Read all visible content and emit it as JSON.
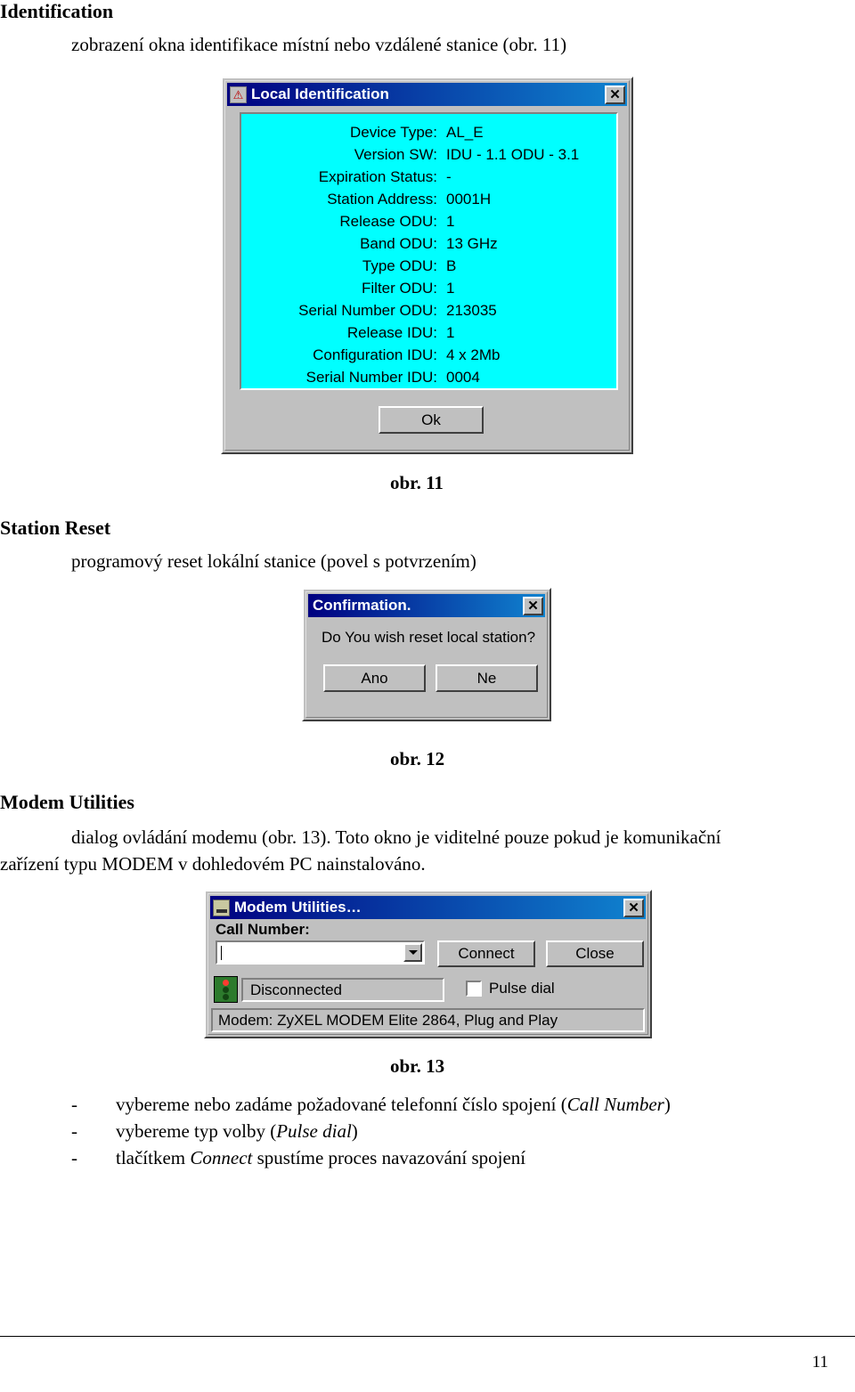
{
  "doc": {
    "section1_title": "Identification",
    "section1_text": "zobrazení okna identifikace místní nebo vzdálené stanice (obr. 11)",
    "fig11_caption": "obr. 11",
    "section2_title": "Station Reset",
    "section2_text": "programový reset lokální stanice (povel s potvrzením)",
    "fig12_caption": "obr. 12",
    "section3_title": "Modem Utilities",
    "section3_text_line1": "dialog ovládání modemu (obr. 13). Toto okno je viditelné pouze pokud je komunikační",
    "section3_text_line2": "zařízení typu MODEM v dohledovém PC nainstalováno.",
    "fig13_caption": "obr. 13",
    "bullets": [
      {
        "dash": "-",
        "text_before": "vybereme nebo zadáme požadované telefonní číslo spojení (",
        "italic": "Call Number",
        "text_after": ")"
      },
      {
        "dash": "-",
        "text_before": "vybereme typ volby (",
        "italic": "Pulse dial",
        "text_after": ")"
      },
      {
        "dash": "-",
        "text_before": "tlačítkem ",
        "italic": "Connect",
        "text_after": " spustíme proces navazování spojení"
      }
    ],
    "page_number": "11"
  },
  "ident_dialog": {
    "title": "Local Identification",
    "icon": "warning-icon",
    "close_label": "✕",
    "rows": [
      {
        "label": "Device Type:",
        "value": "AL_E"
      },
      {
        "label": "Version SW:",
        "value": "IDU - 1.1    ODU - 3.1"
      },
      {
        "label": "Expiration Status:",
        "value": "-"
      },
      {
        "label": "Station Address:",
        "value": "0001H"
      },
      {
        "label": "Release ODU:",
        "value": "1"
      },
      {
        "label": "Band ODU:",
        "value": "13 GHz"
      },
      {
        "label": "Type ODU:",
        "value": "B"
      },
      {
        "label": "Filter ODU:",
        "value": "1"
      },
      {
        "label": "Serial Number ODU:",
        "value": "213035"
      },
      {
        "label": "Release IDU:",
        "value": "1"
      },
      {
        "label": "Configuration IDU:",
        "value": "4 x 2Mb"
      },
      {
        "label": "Serial Number IDU:",
        "value": "0004"
      }
    ],
    "ok_label": "Ok",
    "panel_color": "#00ffff"
  },
  "confirm_dialog": {
    "title": "Confirmation.",
    "close_label": "✕",
    "message": "Do You wish reset local station?",
    "yes_label": "Ano",
    "no_label": "Ne"
  },
  "modem_dialog": {
    "title": "Modem Utilities…",
    "close_label": "✕",
    "call_number_label": "Call Number:",
    "call_number_value": "",
    "connect_label": "Connect",
    "close_button_label": "Close",
    "status_text": "Disconnected",
    "pulse_dial_label": "Pulse dial",
    "pulse_dial_checked": false,
    "modem_info": "Modem: ZyXEL MODEM Elite 2864, Plug and Play"
  }
}
